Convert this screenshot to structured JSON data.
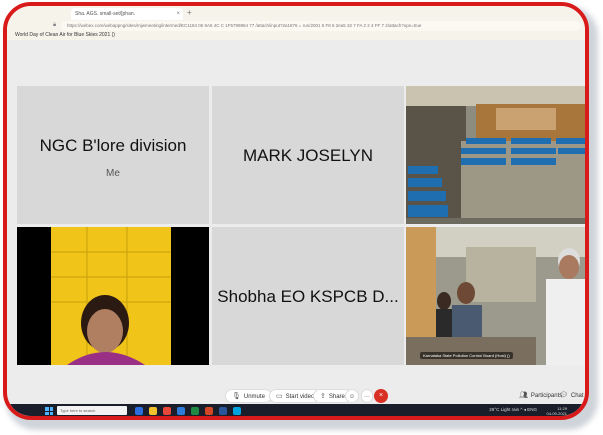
{
  "browser": {
    "tab_title": "Sha. AGS. small-set/[phan.",
    "tab_close": "×",
    "new_tab": "+",
    "address": "https://webex.com/webappng/sites/mjwmeeting/intermed/EC1184 05 9A6 4C C 1F5799864 77 /attach/input?2a1876 = run/2001 5 F8 6 2ea5 32 7 FA 2 2 4 FF 7 2/attach?ops=true",
    "meeting_title": "World Day of Clean Air for Blue Skies 2021 ()"
  },
  "tiles": [
    {
      "name": "NGC B'lore division",
      "sub": "Me"
    },
    {
      "name": "MARK JOSELYN"
    },
    {
      "video": "conference-hall"
    },
    {
      "video": "participant-woman"
    },
    {
      "name": "Shobha EO KSPCB D..."
    },
    {
      "video": "meeting-room",
      "caption": "Karnataka State Pollution Control Board (Host) ()"
    }
  ],
  "controls": {
    "unmute": "Unmute",
    "start_video": "Start video",
    "share": "Share",
    "more": "···",
    "leave": "×",
    "participants": "Participants",
    "chat": "Chat"
  },
  "taskbar": {
    "search_placeholder": "Type here to search",
    "tray_text": "29°C  Light rain  ^  ◂  ENG",
    "time": "11:29",
    "date": "04-09-2021"
  },
  "colors": {
    "frame": "#d91a1a",
    "tile_bg": "#d8d8d8",
    "leave": "#d93025",
    "taskbar": "#1a1e2a"
  }
}
